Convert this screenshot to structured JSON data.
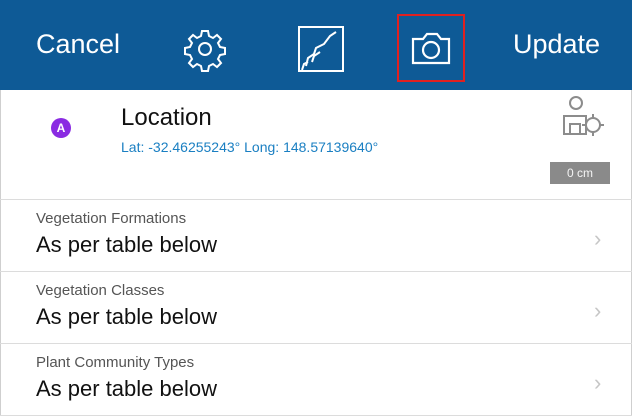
{
  "toolbar": {
    "cancel_label": "Cancel",
    "update_label": "Update",
    "background_color": "#0e5a96",
    "highlight_color": "#e02020",
    "icons": [
      "gear-icon",
      "map-edit-icon",
      "camera-icon"
    ]
  },
  "location": {
    "badge": "A",
    "title": "Location",
    "coords": "Lat: -32.46255243° Long: 148.57139640°",
    "accuracy": "0 cm",
    "icon": "gps-location-icon"
  },
  "fields": [
    {
      "label": "Vegetation Formations",
      "value": "As per table below"
    },
    {
      "label": "Vegetation Classes",
      "value": "As per table below"
    },
    {
      "label": "Plant Community Types",
      "value": "As per table below"
    }
  ],
  "chevron": "›"
}
